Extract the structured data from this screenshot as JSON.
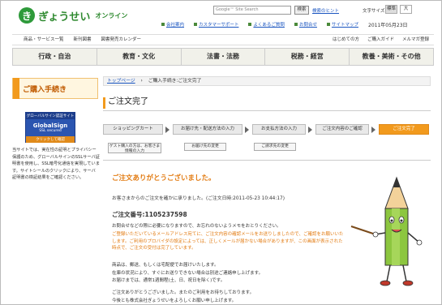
{
  "header": {
    "logo_mark": "き",
    "logo_text": "ぎょうせい",
    "logo_sub": "オンライン",
    "search_placeholder": "Google™ Site Search",
    "search_button": "検索",
    "search_hint": "検索のヒント",
    "font_size_label": "文字サイズ",
    "font_std": "標準",
    "font_big": "大",
    "top_links": [
      "会社案内",
      "カスタマーサポート",
      "よくあるご質問",
      "お問合せ",
      "サイトマップ"
    ],
    "date": "2011年05月23日"
  },
  "subnav": {
    "left": [
      "商品・サービス一覧",
      "新刊図書",
      "図書発売カレンダー"
    ],
    "right": [
      "はじめての方",
      "ご購入ガイド",
      "メルマガ登録"
    ]
  },
  "mainnav": [
    "行政・自治",
    "教育・文化",
    "法書・法務",
    "税務・経営",
    "教養・美術・その他"
  ],
  "sidebar": {
    "title": "ご購入手続き",
    "ssl_top": "グローバルサイン認証サイト",
    "ssl_mid": "GlobalSign",
    "ssl_sub": "SSL secured",
    "ssl_bot": "クリックして確認",
    "text": "当サイトでは、実在性の証明とプライバシー保護のため、グローバルサインのSSLサーバ証明書を使用し、SSL暗号化通信を実現しています。サイトシールのクリックにより、サーバ証明書の検証結果をご確認ください。"
  },
  "breadcrumb": {
    "home": "トップページ",
    "current": "ご購入手続き:ご注文完了"
  },
  "page_title": "ご注文完了",
  "steps": [
    "ショッピングカート",
    "お届け先・配送方法の入力",
    "お支払方法の入力",
    "ご注文内容のご確認",
    "ご注文完了"
  ],
  "substeps": [
    "ゲスト購入の方は、お客さま情報の入力",
    "お届け先の変更",
    "ご請求先の変更"
  ],
  "content": {
    "thanks": "ご注文ありがとうございました。",
    "accept": "お客さまからのご注文を確かに承りました。(ご注文日時:2011-05-23 10:44:17)",
    "order_no": "ご注文番号:1105237598",
    "para1": "お問合せなどの際に必要になりますので、お忘れのないようメモをおとりください。",
    "para2": "ご登録いただいているメールアドレス宛てに、ご注文内容の確認メールをお送りしましたので、ご確認をお願いいたします。ご利用のプロバイダの設定によっては、正しくメールが届かない場合がありますが、この画面が表示された時点で、ご注文の受付は完了しています。",
    "para3": "商品は、郵送、もしくは宅配便でお届けいたします。",
    "para4": "在庫の状況により、すぐにお送りできない場合は別途ご連絡申し上げます。",
    "para5": "お届けまでは、通常1週間程(土、日、祝日を除く)です。",
    "para6": "ご注文ありがとうございました。またのご利用をお待ちしております。",
    "para7": "今後とも株式会社ぎょうせいをよろしくお願い申し上げます。"
  },
  "colors": {
    "brand_green": "#2e9a3a",
    "accent_orange": "#f29a1d"
  }
}
